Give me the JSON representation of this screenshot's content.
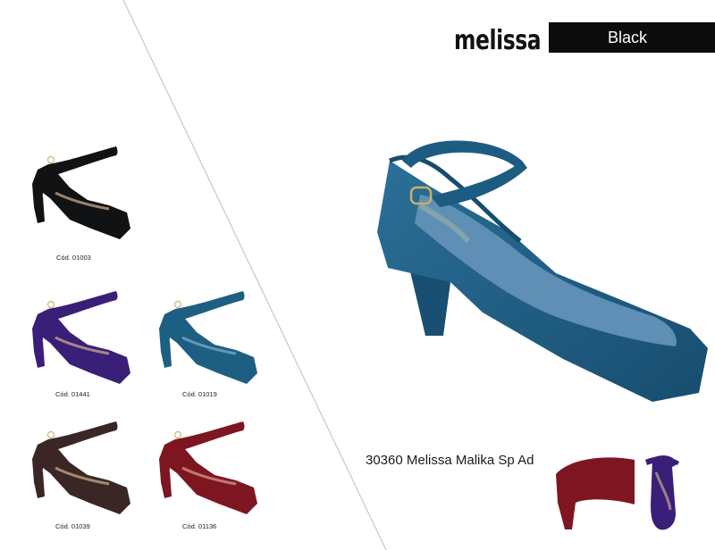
{
  "brand": {
    "logo_text": "melissa",
    "registered": "®",
    "line_label": "Black"
  },
  "colors": {
    "black": "#111214",
    "purple": "#3a1f78",
    "teal_blue": "#1d5f82",
    "brown": "#3a2624",
    "red": "#7e1622",
    "hero_blue": "#1f5f86"
  },
  "variants": [
    {
      "code": "Cód. 01003",
      "color_name": "black"
    },
    {
      "code": "Cód. 01441",
      "color_name": "purple"
    },
    {
      "code": "Cód. 01019",
      "color_name": "teal_blue"
    },
    {
      "code": "Cód. 01039",
      "color_name": "brown"
    },
    {
      "code": "Cód. 01136",
      "color_name": "red"
    }
  ],
  "product": {
    "name": "30360 Melissa Malika Sp Ad"
  }
}
